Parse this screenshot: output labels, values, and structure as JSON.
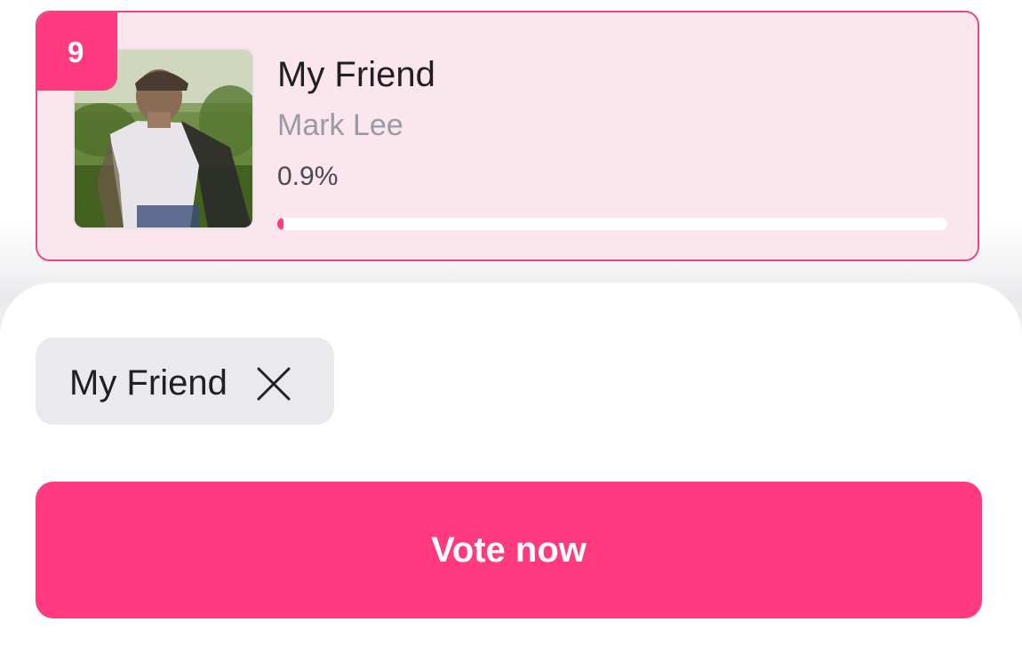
{
  "song": {
    "rank": "9",
    "title": "My Friend",
    "artist": "Mark Lee",
    "percent_label": "0.9%",
    "progress_fraction": 0.009
  },
  "selection": {
    "chip_label": "My Friend",
    "remove_icon": "close-icon"
  },
  "actions": {
    "vote_label": "Vote now"
  },
  "colors": {
    "accent": "#ff3a7f",
    "card_background": "#fce6ee",
    "card_border": "#e24a87",
    "chip_background": "#e9e9ee"
  }
}
